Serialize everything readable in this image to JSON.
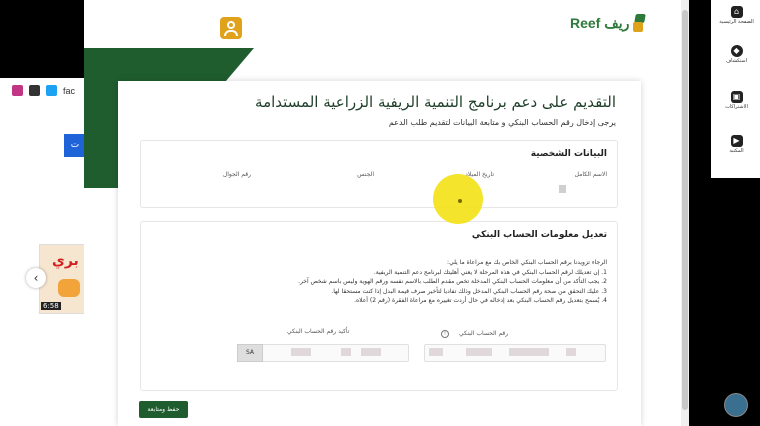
{
  "left_panel": {
    "social_text": "fac",
    "blue_button_label": "ت",
    "video_time": "6:58",
    "video_overlay": "بري"
  },
  "right_panel": {
    "items": [
      {
        "label": "الصفحة الرئيسية",
        "icon": "home-icon"
      },
      {
        "label": "استكشاف",
        "icon": "compass-icon"
      },
      {
        "label": "الاشتراكات",
        "icon": "subscriptions-icon"
      },
      {
        "label": "المكتبة",
        "icon": "library-icon"
      }
    ]
  },
  "header": {
    "logo_text": "Reef ريف"
  },
  "form": {
    "title": "التقديم على دعم برنامج التنمية الريفية الزراعية المستدامة",
    "subtitle": "يرجى إدخال رقم الحساب البنكي و متابعة البيانات لتقديم طلب الدعم",
    "personal": {
      "title": "البيانات الشخصية",
      "columns": [
        "الاسم الكامل",
        "تاريخ الميلاد",
        "الجنس",
        "رقم الجوال"
      ]
    },
    "bank": {
      "title": "تعديل معلومات الحساب البنكي",
      "instructions": [
        "الرجاء تزويدنا برقم الحساب البنكي الخاص بك مع مراعاة ما يلي:",
        "1. إن تعديلك لرقم الحساب البنكي في هذه المرحلة لا يعني أهليتك لبرنامج دعم التنمية الريفية.",
        "2. يجب التأكد من أن معلومات الحساب البنكي المدخلة تخص مقدم الطلب بالاسم نفسه ورقم الهوية وليس باسم شخص آخر.",
        "3. عليك التحقق من صحة رقم الحساب البنكي المدخل وذلك تفاديا لتأخير صرف قيمة البدل إذا كنت مستحقا لها.",
        "4. يُسمح بتعديل رقم الحساب البنكي بعد إدخاله في حال أردت تغييره مع مراعاة الفقرة (رقم 2) أعلاه."
      ],
      "bank_label": "رقم الحساب البنكي",
      "confirm_label": "تأكيد رقم الحساب البنكي",
      "prefix": "SA"
    },
    "submit_label": "حفظ ومتابعة"
  }
}
